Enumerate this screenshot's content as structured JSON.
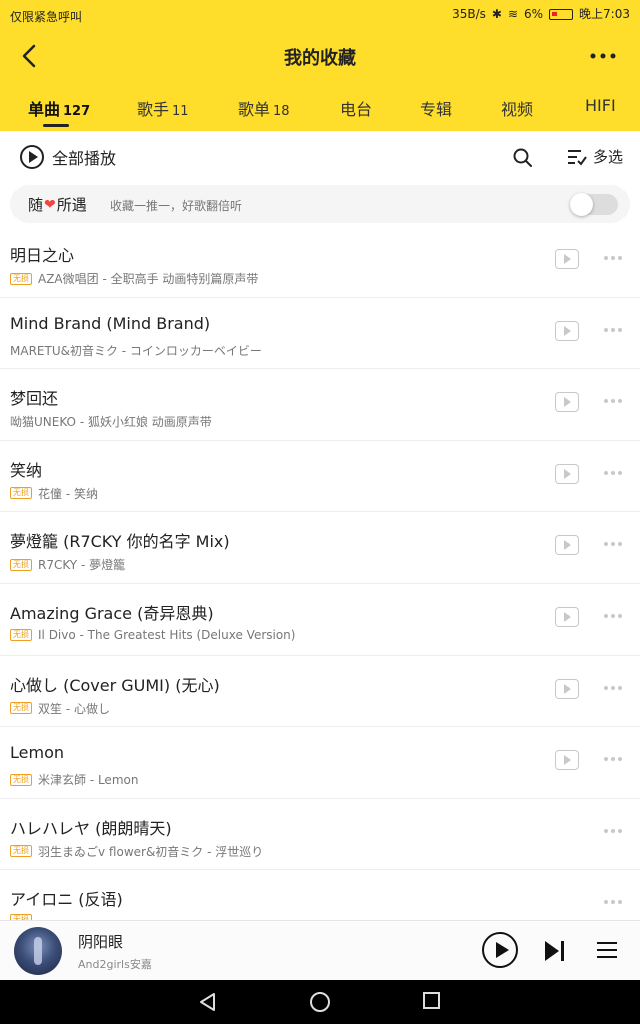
{
  "status_bar": {
    "left_text": "仅限紧急呼叫",
    "speed": "35B/s",
    "battery_pct": "6%",
    "time": "晚上7:03"
  },
  "header": {
    "title": "我的收藏",
    "back_icon": "chevron-left-icon",
    "more_icon": "more-horizontal-icon",
    "background": "#fedd2b"
  },
  "tabs": [
    {
      "label": "单曲",
      "count": "127",
      "active": true
    },
    {
      "label": "歌手",
      "count": "11"
    },
    {
      "label": "歌单",
      "count": "18"
    },
    {
      "label": "电台",
      "count": ""
    },
    {
      "label": "专辑",
      "count": ""
    },
    {
      "label": "视频",
      "count": ""
    },
    {
      "label": "HIFI",
      "count": ""
    }
  ],
  "toolbar": {
    "play_all_label": "全部播放",
    "multi_select_label": "多选"
  },
  "encounter": {
    "title_before": "随",
    "title_after": "所遇",
    "subtitle": "收藏一推一，好歌翻倍听",
    "toggle_on": false
  },
  "songs": [
    {
      "title": "明日之心",
      "badge": "无损",
      "meta": "AZA微唱团 - 全职高手 动画特别篇原声带",
      "mv": true
    },
    {
      "title": "Mind Brand (Mind Brand)",
      "badge": "",
      "meta": "MARETU&初音ミク - コインロッカーベイビー",
      "mv": true
    },
    {
      "title": "梦回还",
      "badge": "",
      "meta": "呦猫UNEKO - 狐妖小红娘 动画原声带",
      "mv": true
    },
    {
      "title": "笑纳",
      "badge": "无损",
      "meta": "花僮 - 笑纳",
      "mv": true
    },
    {
      "title": "夢燈籠 (R7CKY 你的名字 Mix)",
      "badge": "无损",
      "meta": "R7CKY - 夢燈籠",
      "mv": true
    },
    {
      "title": "Amazing Grace (奇异恩典)",
      "badge": "无损",
      "meta": "Il Divo - The Greatest Hits (Deluxe Version)",
      "mv": true
    },
    {
      "title": "心做し (Cover GUMI) (无心)",
      "badge": "无损",
      "meta": "双笙 - 心做し",
      "mv": true
    },
    {
      "title": "Lemon",
      "badge": "无损",
      "meta": "米津玄師 - Lemon",
      "mv": true
    },
    {
      "title": "ハレハレヤ (朗朗晴天)",
      "badge": "无损",
      "meta": "羽生まゐごv flower&初音ミク - 浮世巡り",
      "mv": false
    },
    {
      "title": "アイロニ (反语)",
      "badge": "无损",
      "meta": "",
      "mv": false
    }
  ],
  "player": {
    "title": "阴阳眼",
    "artist": "And2girls安嘉"
  }
}
